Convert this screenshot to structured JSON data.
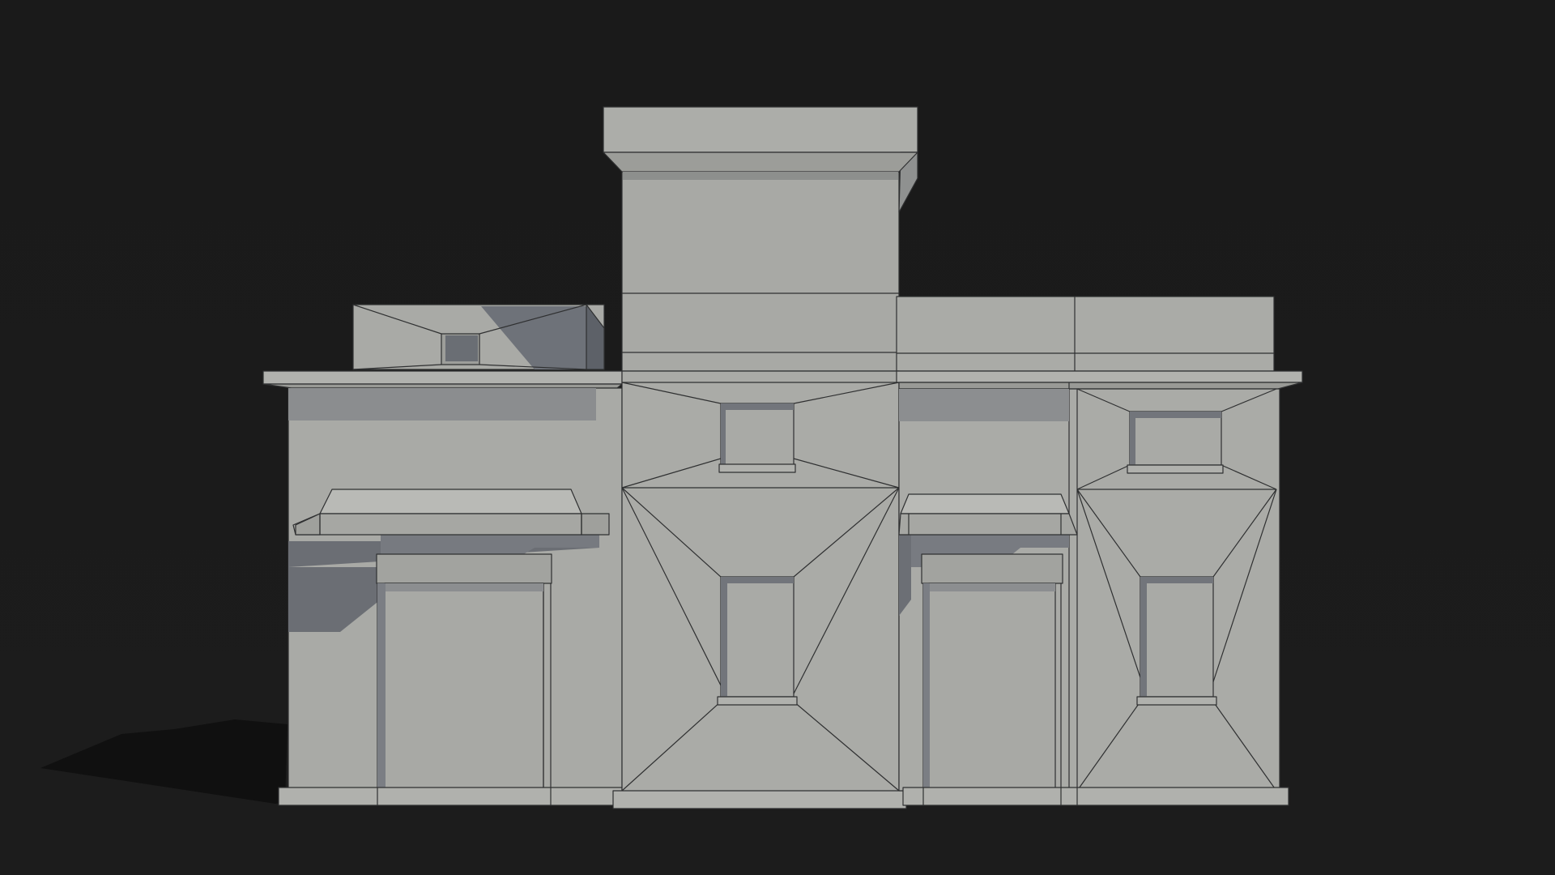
{
  "scene": {
    "subject": "building-model",
    "colors": {
      "background": "#1b1b1b",
      "wall": "#a9aaa6",
      "wall_light": "#b3b4b0",
      "wall_shadow": "#6f7278",
      "edge": "#2c2d2e",
      "ground_shadow": "#121212"
    }
  }
}
